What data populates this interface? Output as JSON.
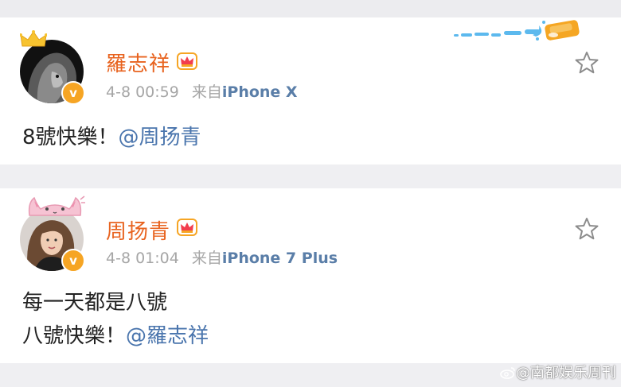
{
  "posts": [
    {
      "username": "羅志祥",
      "timestamp": "4-8 00:59",
      "source_prefix": "来自",
      "device": "iPhone X",
      "text": "8號快樂！",
      "mention": "@周扬青",
      "avatar_icon": "lion-avatar",
      "badge_text": "v"
    },
    {
      "username": "周扬青",
      "timestamp": "4-8 01:04",
      "source_prefix": "来自",
      "device": "iPhone 7 Plus",
      "text_line1": "每一天都是八號",
      "text_line2": "八號快樂！",
      "mention": "@羅志祥",
      "avatar_icon": "woman-avatar",
      "badge_text": "v"
    }
  ],
  "watermark": "@南都娱乐周刊",
  "colors": {
    "username": "#e8631f",
    "meta": "#a6a6a6",
    "device": "#5a7ea8",
    "mention": "#4a75ad",
    "badge": "#f6a524"
  }
}
